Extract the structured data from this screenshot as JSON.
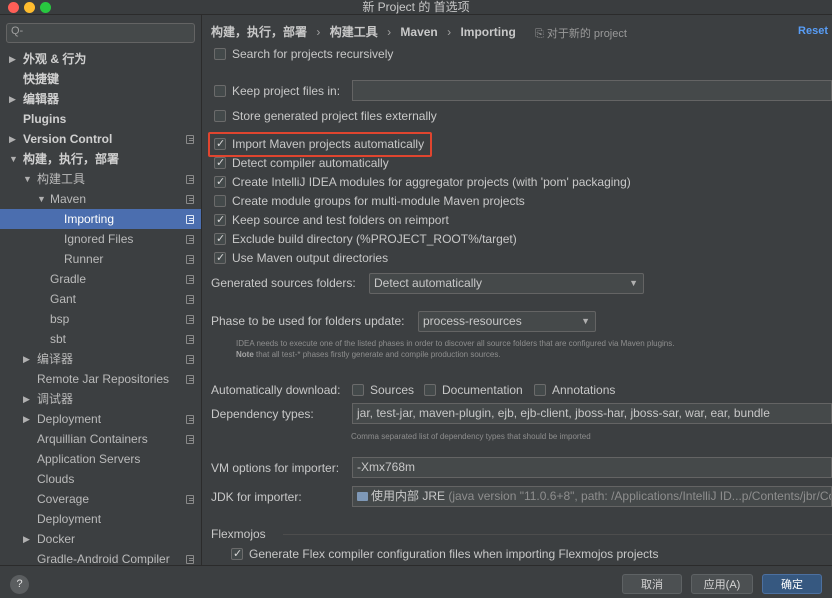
{
  "window": {
    "title": "新 Project 的 首选项"
  },
  "search": {
    "placeholder": "Q-"
  },
  "sidebar": {
    "items": [
      {
        "label": "外观 & 行为",
        "arrow": "▶",
        "bold": true
      },
      {
        "label": "快捷键",
        "arrow": "",
        "bold": true
      },
      {
        "label": "编辑器",
        "arrow": "▶",
        "bold": true
      },
      {
        "label": "Plugins",
        "arrow": "",
        "bold": true
      },
      {
        "label": "Version Control",
        "arrow": "▶",
        "bold": true
      },
      {
        "label": "构建，执行，部署",
        "arrow": "▼",
        "bold": true
      },
      {
        "label": "构建工具",
        "arrow": "▼"
      },
      {
        "label": "Maven",
        "arrow": "▼"
      },
      {
        "label": "Importing",
        "arrow": "",
        "selected": true
      },
      {
        "label": "Ignored Files",
        "arrow": ""
      },
      {
        "label": "Runner",
        "arrow": ""
      },
      {
        "label": "Gradle",
        "arrow": ""
      },
      {
        "label": "Gant",
        "arrow": ""
      },
      {
        "label": "bsp",
        "arrow": ""
      },
      {
        "label": "sbt",
        "arrow": ""
      },
      {
        "label": "编译器",
        "arrow": "▶"
      },
      {
        "label": "Remote Jar Repositories",
        "arrow": ""
      },
      {
        "label": "调试器",
        "arrow": "▶"
      },
      {
        "label": "Deployment",
        "arrow": "▶"
      },
      {
        "label": "Arquillian Containers",
        "arrow": ""
      },
      {
        "label": "Application Servers",
        "arrow": ""
      },
      {
        "label": "Clouds",
        "arrow": ""
      },
      {
        "label": "Coverage",
        "arrow": ""
      },
      {
        "label": "Deployment",
        "arrow": ""
      },
      {
        "label": "Docker",
        "arrow": "▶"
      },
      {
        "label": "Gradle-Android Compiler",
        "arrow": ""
      }
    ]
  },
  "breadcrumb": {
    "part1": "构建，执行，部署",
    "part2": "构建工具",
    "part3": "Maven",
    "part4": "Importing",
    "sep": "›"
  },
  "project_note": "⎘ 对于新的 project",
  "reset_label": "Reset",
  "options": {
    "search_recursively": {
      "label": "Search for projects recursively",
      "checked": false
    },
    "keep_project_files": {
      "label": "Keep project files in:",
      "checked": false,
      "value": ""
    },
    "store_externally": {
      "label": "Store generated project files externally",
      "checked": false
    },
    "import_automatically": {
      "label": "Import Maven projects automatically",
      "checked": true
    },
    "detect_compiler": {
      "label": "Detect compiler automatically",
      "checked": true
    },
    "create_modules": {
      "label": "Create IntelliJ IDEA modules for aggregator projects (with 'pom' packaging)",
      "checked": true
    },
    "create_module_groups": {
      "label": "Create module groups for multi-module Maven projects",
      "checked": false
    },
    "keep_source_folders": {
      "label": "Keep source and test folders on reimport",
      "checked": true
    },
    "exclude_build_dir": {
      "label": "Exclude build directory (%PROJECT_ROOT%/target)",
      "checked": true
    },
    "use_output_dirs": {
      "label": "Use Maven output directories",
      "checked": true
    }
  },
  "generated_sources": {
    "label": "Generated sources folders:",
    "value": "Detect automatically"
  },
  "phase": {
    "label": "Phase to be used for folders update:",
    "value": "process-resources",
    "hint1": "IDEA needs to execute one of the listed phases in order to discover all source folders that are configured via Maven plugins.",
    "hint2_bold": "Note",
    "hint2": " that all test-* phases firstly generate and compile production sources."
  },
  "auto_download": {
    "label": "Automatically download:",
    "sources": {
      "label": "Sources",
      "checked": false
    },
    "documentation": {
      "label": "Documentation",
      "checked": false
    },
    "annotations": {
      "label": "Annotations",
      "checked": false
    }
  },
  "dependency_types": {
    "label": "Dependency types:",
    "value": "jar, test-jar, maven-plugin, ejb, ejb-client, jboss-har, jboss-sar, war, ear, bundle",
    "hint": "Comma separated list of dependency types that should be imported"
  },
  "vm_options": {
    "label": "VM options for importer:",
    "value": "-Xmx768m"
  },
  "jdk": {
    "label": "JDK for importer:",
    "value": "使用内部 JRE",
    "detail": " (java version \"11.0.6+8\", path: /Applications/IntelliJ ID...p/Contents/jbr/Co"
  },
  "flexmojos": {
    "title": "Flexmojos",
    "generate_config": {
      "label": "Generate Flex compiler configuration files when importing Flexmojos projects",
      "checked": true
    }
  },
  "footer": {
    "help": "?",
    "cancel": "取消",
    "apply": "应用(A)",
    "ok": "确定"
  },
  "colors": {
    "selection": "#4b6eaf",
    "highlight_border": "#e0452f",
    "link": "#589df6",
    "primary_button": "#365880"
  }
}
